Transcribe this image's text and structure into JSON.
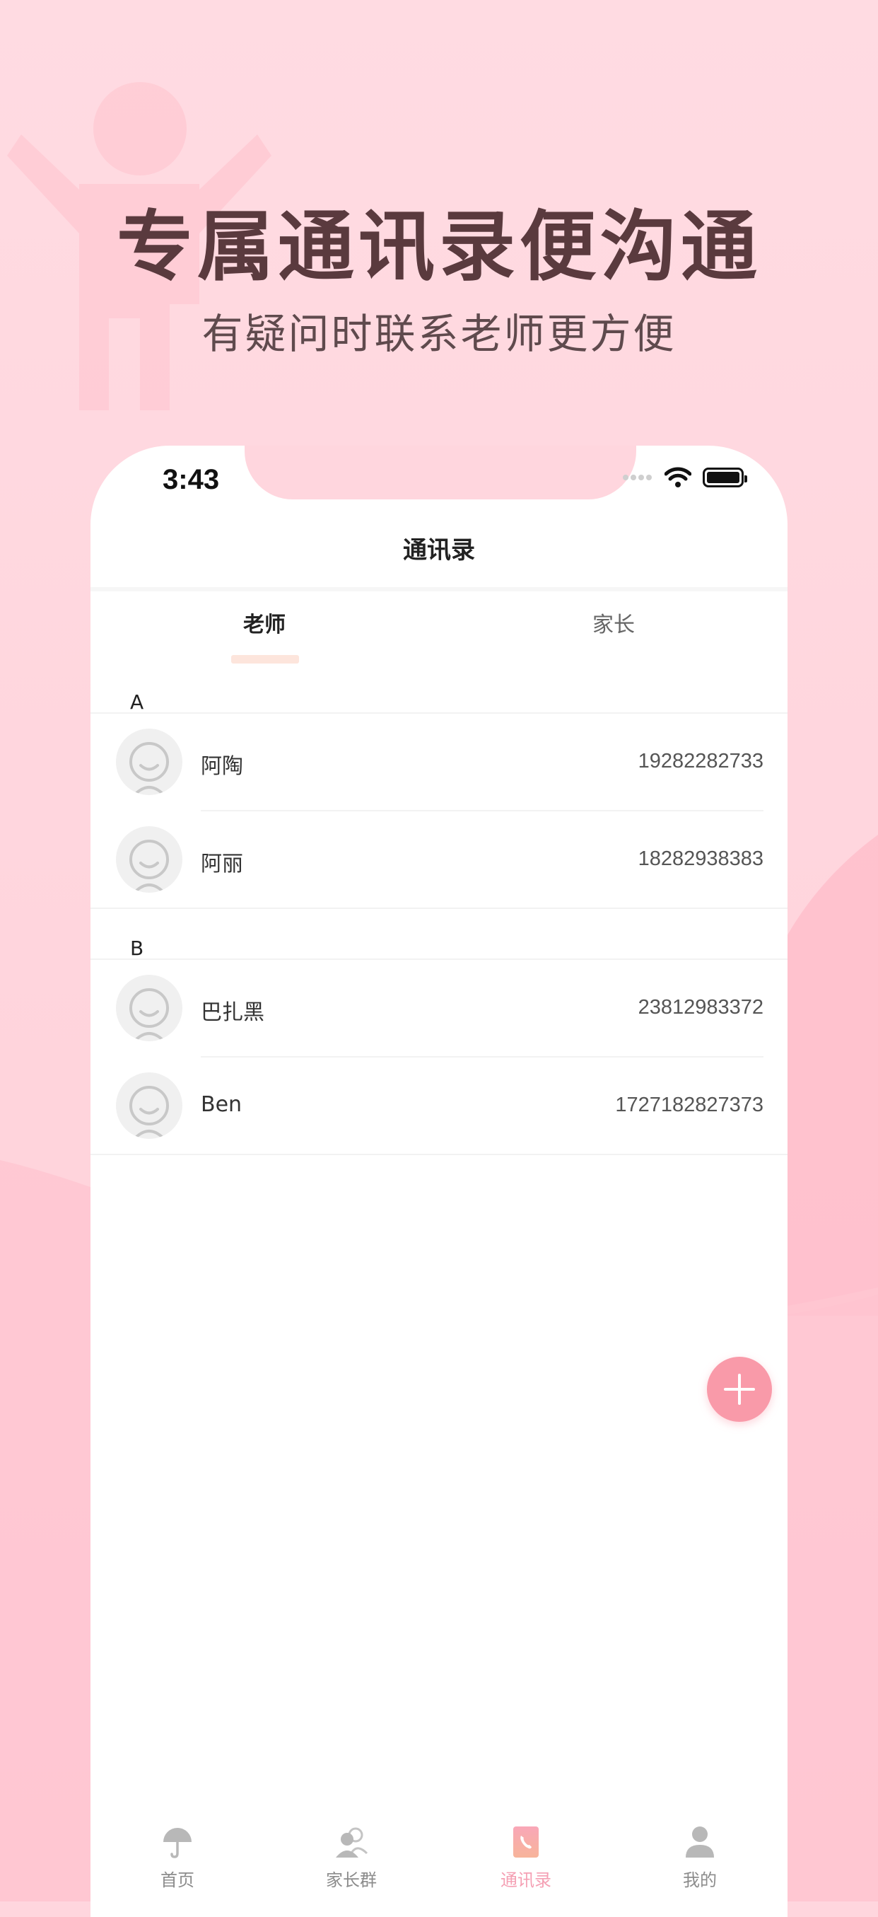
{
  "promo": {
    "headline": "专属通讯录便沟通",
    "subline": "有疑问时联系老师更方便"
  },
  "status_bar": {
    "time": "3:43",
    "icons": [
      "signal-icon",
      "wifi-icon",
      "battery-icon"
    ]
  },
  "nav": {
    "title": "通讯录"
  },
  "tabs": [
    {
      "label": "老师",
      "active": true
    },
    {
      "label": "家长",
      "active": false
    }
  ],
  "sections": [
    {
      "letter": "A",
      "contacts": [
        {
          "name": "阿陶",
          "phone": "19282282733"
        },
        {
          "name": "阿丽",
          "phone": "18282938383"
        }
      ]
    },
    {
      "letter": "B",
      "contacts": [
        {
          "name": "巴扎黑",
          "phone": "23812983372"
        },
        {
          "name": "Ben",
          "phone": "1727182827373"
        }
      ]
    }
  ],
  "fab": {
    "icon": "plus-icon"
  },
  "tabbar": [
    {
      "label": "首页",
      "icon": "umbrella-icon",
      "active": false
    },
    {
      "label": "家长群",
      "icon": "group-icon",
      "active": false
    },
    {
      "label": "通讯录",
      "icon": "phone-book-icon",
      "active": true
    },
    {
      "label": "我的",
      "icon": "person-icon",
      "active": false
    }
  ],
  "colors": {
    "background": "#ffd6de",
    "accent": "#f99aa9",
    "headline": "#5a3a3e",
    "tab_indicator": "#fde5dc"
  }
}
